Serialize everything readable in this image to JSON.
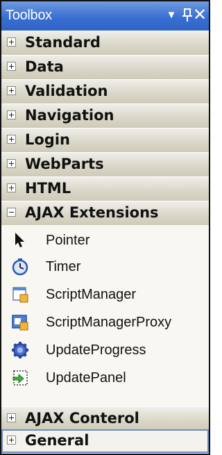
{
  "window": {
    "title": "Toolbox",
    "buttons": [
      {
        "icon": "dropdown-arrow-icon",
        "glyph": "▼"
      },
      {
        "icon": "pin-icon",
        "glyph": "ᴨ"
      },
      {
        "icon": "close-icon",
        "glyph": "✕"
      }
    ]
  },
  "categories_top": [
    {
      "label": "Standard"
    },
    {
      "label": "Data"
    },
    {
      "label": "Validation"
    },
    {
      "label": "Navigation"
    },
    {
      "label": "Login"
    },
    {
      "label": "WebParts"
    },
    {
      "label": "HTML"
    },
    {
      "label": "AJAX Extensions",
      "expanded": true
    }
  ],
  "ajax_items": [
    {
      "label": "Pointer",
      "icon": "pointer-icon"
    },
    {
      "label": "Timer",
      "icon": "timer-icon"
    },
    {
      "label": "ScriptManager",
      "icon": "script-manager-icon"
    },
    {
      "label": "ScriptManagerProxy",
      "icon": "script-manager-proxy-icon"
    },
    {
      "label": "UpdateProgress",
      "icon": "update-progress-icon"
    },
    {
      "label": "UpdatePanel",
      "icon": "update-panel-icon"
    }
  ],
  "categories_bottom": [
    {
      "label": "AJAX Conterol"
    },
    {
      "label": "General",
      "selected": true
    }
  ],
  "colors": {
    "title_bar": "#3a6fd2",
    "category_bg": "#d9d6c7",
    "selection_border": "#6e8cc4"
  }
}
